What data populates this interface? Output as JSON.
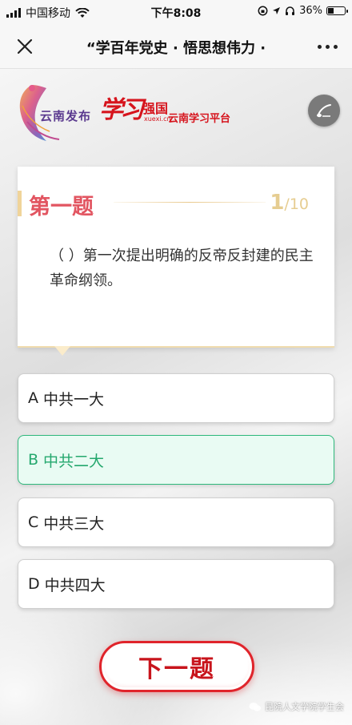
{
  "status_bar": {
    "carrier": "中国移动",
    "time": "下午8:08",
    "battery": "36%",
    "battery_level": 0.36
  },
  "nav": {
    "title": "“学百年党史 · 悟思想伟力 ·",
    "close_icon": "close-icon",
    "more_icon": "more-icon"
  },
  "logos": {
    "yunnan": "云南发布",
    "xuexi_script": "学习",
    "xuexi_qiangguo": "强国",
    "xuexi_url": "xuexi.cn",
    "xuexi_platform": "云南学习平台"
  },
  "question": {
    "label": "第一题",
    "current": "1",
    "total": "/10",
    "text": "（ ）第一次提出明确的反帝反封建的民主革命纲领。"
  },
  "options": [
    {
      "letter": "A",
      "text": "中共一大",
      "selected": false
    },
    {
      "letter": "B",
      "text": "中共二大",
      "selected": true
    },
    {
      "letter": "C",
      "text": "中共三大",
      "selected": false
    },
    {
      "letter": "D",
      "text": "中共四大",
      "selected": false
    }
  ],
  "next_button": "下一题",
  "watermark": "昆院人文学院学生会",
  "colors": {
    "accent_red": "#e0242b",
    "title_red": "#e25561",
    "gold": "#e6cd91",
    "selected_green": "#25a86e",
    "selected_bg": "#e9fbf3"
  }
}
